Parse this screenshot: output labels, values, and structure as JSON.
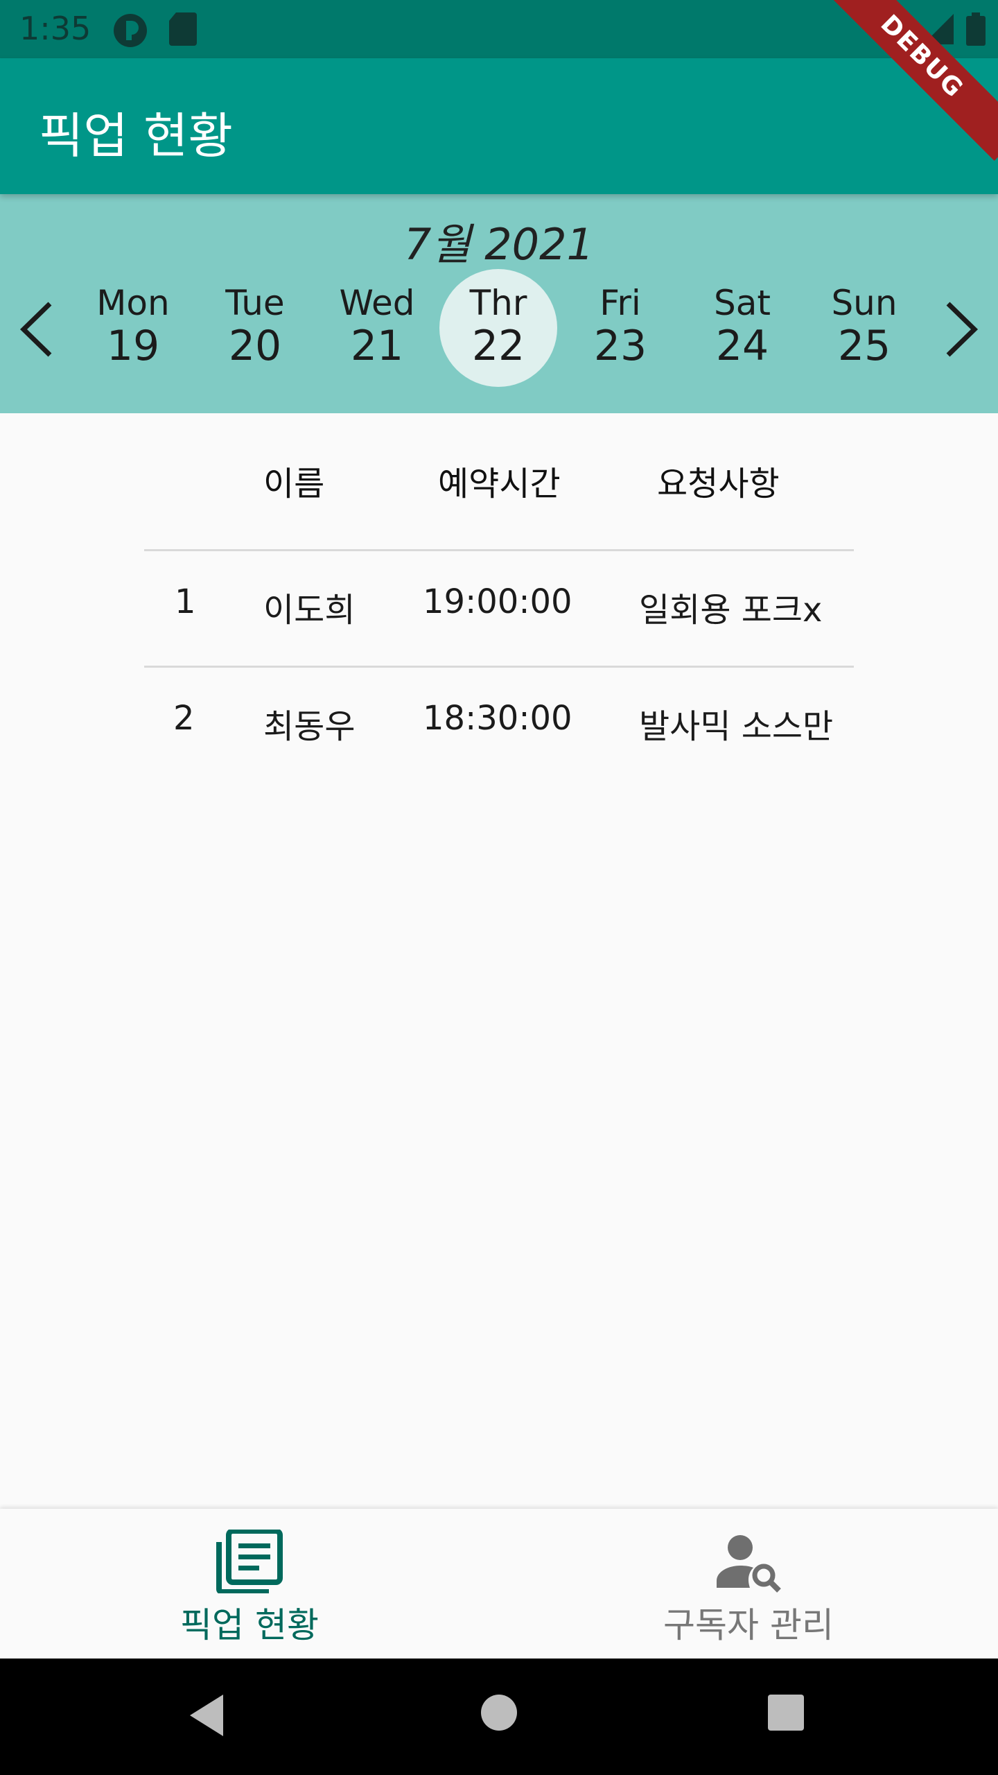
{
  "status_bar": {
    "time": "1:35"
  },
  "debug_label": "DEBUG",
  "app_bar": {
    "title": "픽업 현황"
  },
  "calendar": {
    "month_label": "7월 2021",
    "days": [
      {
        "name": "Mon",
        "num": "19"
      },
      {
        "name": "Tue",
        "num": "20"
      },
      {
        "name": "Wed",
        "num": "21"
      },
      {
        "name": "Thr",
        "num": "22"
      },
      {
        "name": "Fri",
        "num": "23"
      },
      {
        "name": "Sat",
        "num": "24"
      },
      {
        "name": "Sun",
        "num": "25"
      }
    ],
    "selected_index": 3
  },
  "table": {
    "headers": {
      "name": "이름",
      "time": "예약시간",
      "request": "요청사항"
    },
    "rows": [
      {
        "index": "1",
        "name": "이도희",
        "time": "19:00:00",
        "request": "일회용 포크x"
      },
      {
        "index": "2",
        "name": "최동우",
        "time": "18:30:00",
        "request": "발사믹 소스만"
      }
    ]
  },
  "bottom_nav": {
    "items": [
      {
        "label": "픽업 현황",
        "icon": "article-icon",
        "active": true
      },
      {
        "label": "구독자 관리",
        "icon": "person-search-icon",
        "active": false
      }
    ]
  },
  "colors": {
    "primary": "#009688",
    "primary_dark": "#00796b",
    "calendar_bg": "#80cbc4",
    "selected_day_bg": "#dff0ee",
    "active_nav": "#00695c",
    "inactive_nav": "#777777"
  }
}
